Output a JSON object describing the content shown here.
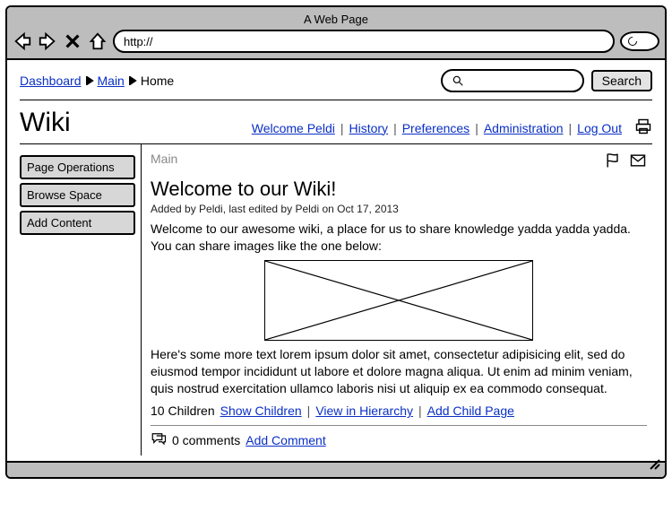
{
  "browser": {
    "title": "A Web Page",
    "url": "http://"
  },
  "breadcrumb": {
    "dashboard": "Dashboard",
    "main": "Main",
    "home": "Home"
  },
  "search": {
    "button": "Search"
  },
  "wiki": {
    "title": "Wiki"
  },
  "menu": {
    "welcome": "Welcome Peldi",
    "history": "History",
    "preferences": "Preferences",
    "administration": "Administration",
    "logout": "Log Out"
  },
  "sidebar": {
    "pageops": "Page Operations",
    "browse": "Browse Space",
    "addcontent": "Add Content"
  },
  "page": {
    "crumb": "Main",
    "title": "Welcome to our Wiki!",
    "byline": "Added by Peldi, last edited by Peldi on Oct 17, 2013",
    "intro": "Welcome to our awesome wiki, a place for us to share knowledge yadda yadda yadda. You can share images like the one below:",
    "lorem": "Here's some more text lorem ipsum dolor sit amet, consectetur adipisicing elit, sed do eiusmod tempor incididunt ut labore et dolore magna aliqua. Ut enim ad minim veniam, quis nostrud exercitation ullamco laboris nisi ut aliquip ex ea commodo consequat."
  },
  "children": {
    "count": "10 Children",
    "show": "Show Children",
    "hierarchy": "View in Hierarchy",
    "add": "Add Child Page"
  },
  "comments": {
    "count": "0 comments",
    "add": "Add Comment"
  }
}
